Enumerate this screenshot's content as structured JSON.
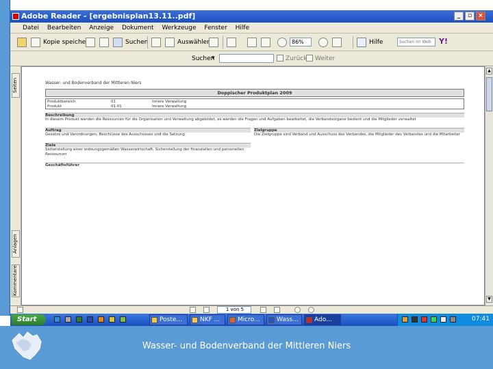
{
  "window": {
    "title": "Adobe Reader - [ergebnisplan13.11..pdf]"
  },
  "menu": [
    "Datei",
    "Bearbeiten",
    "Anzeige",
    "Dokument",
    "Werkzeuge",
    "Fenster",
    "Hilfe"
  ],
  "toolbar": {
    "copy_label": "Kopie speichern",
    "search_label": "Suchen",
    "select_label": "Auswählen",
    "zoom_value": "86%",
    "help_label": "Hilfe",
    "web_search_placeholder": "Suchen im Web"
  },
  "findbar": {
    "label": "Suchen",
    "back_label": "Zurück",
    "next_label": "Weiter"
  },
  "sidetabs": [
    "Seiten",
    "Anlagen",
    "Kommentare"
  ],
  "document": {
    "header": "Wasser- und Bodenverband der Mittleren Niers",
    "plan_title": "Doppischer Produktplan 2009",
    "rows": [
      {
        "a": "Produktbereich",
        "b": "01",
        "c": "Innere Verwaltung"
      },
      {
        "a": "Produkt",
        "b": "01.01",
        "c": "Innere Verwaltung"
      }
    ],
    "section_beschreibung": "Beschreibung",
    "beschreibung_text": "In diesem Produkt werden die Ressourcen für die Organisation und Verwaltung abgebildet, es werden die Fragen und Aufgaben bearbeitet, die Verbandsorgane bedient und die Mitglieder verwaltet",
    "section_auftrag": "Auftrag",
    "auftrag_text": "Gesetze und Verordnungen, Beschlüsse des Ausschusses und die Satzung",
    "section_zielgruppe": "Zielgruppe",
    "zielgruppe_text": "Die Zielgruppe sind Verband und Ausschuss des Verbandes, die Mitglieder des Verbandes und die Mitarbeiter",
    "section_ziele": "Ziele",
    "ziele_text": "Sicherstellung einer ordnungsgemäßen Wasserwirtschaft, Sicherstellung der finanziellen und personellen Ressourcen",
    "section_gf": "Geschäftsführer"
  },
  "statusbar": {
    "page_indicator": "1 von 5"
  },
  "taskbar": {
    "start_label": "Start",
    "tasks": [
      "Poste...",
      "NKF ...",
      "Micro...",
      "Wass...",
      "Ado..."
    ],
    "clock": "07:41"
  },
  "footer": {
    "text": "Wasser- und Bodenverband der Mittleren Niers"
  },
  "colors": {
    "slide_blue": "#5b9bd5",
    "xp_blue": "#1c4fc0",
    "start_green": "#2e7d2e"
  }
}
